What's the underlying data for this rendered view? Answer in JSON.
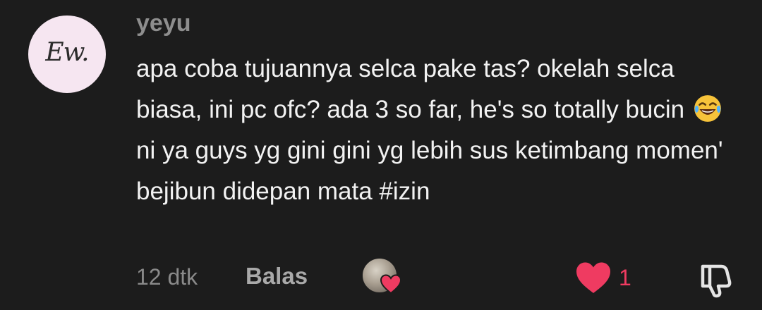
{
  "comment": {
    "avatar_text": "Ew.",
    "username": "yeyu",
    "text_before_emoji": "apa coba tujuannya selca pake tas? okelah selca biasa, ini pc ofc? ada 3 so far, he's so totally bucin",
    "emoji": "face-with-tears-of-joy",
    "text_after_emoji": "ni ya guys yg gini gini yg lebih sus ketimbang momen' bejibun didepan mata #izin",
    "time": "12 dtk",
    "reply_label": "Balas",
    "like_count": "1"
  },
  "colors": {
    "background": "#1c1c1c",
    "username": "#8e8e8e",
    "text": "#f2f2f2",
    "muted": "#8a8a8a",
    "like": "#ef3b61",
    "avatar_bg": "#f6e6f1"
  },
  "icons": {
    "like": "heart-icon",
    "dislike": "thumbs-down-icon",
    "liker_badge": "heart-icon"
  }
}
